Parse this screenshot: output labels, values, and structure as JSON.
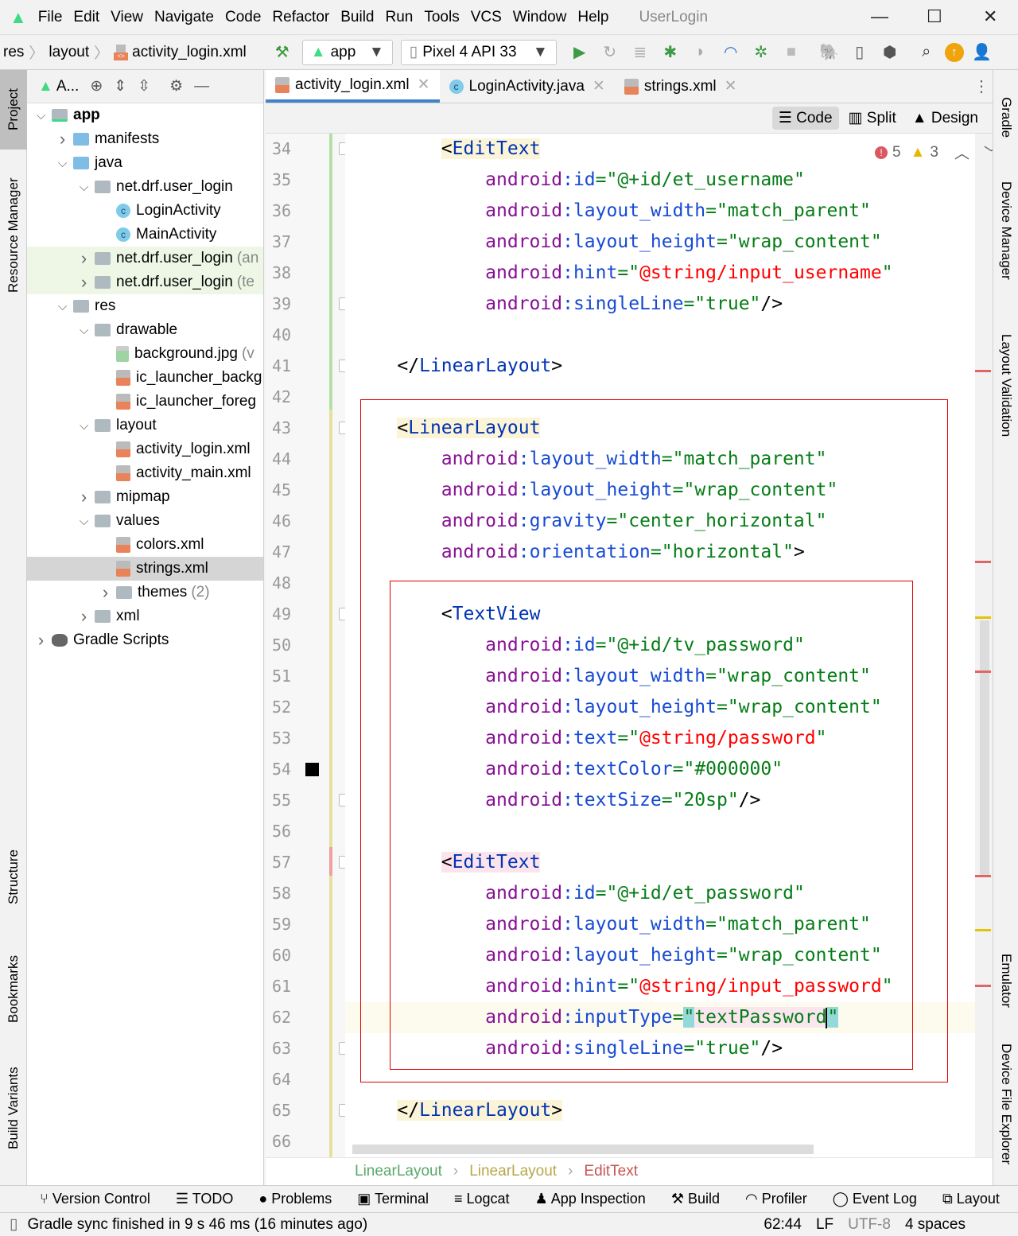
{
  "menu": {
    "items": [
      "File",
      "Edit",
      "View",
      "Navigate",
      "Code",
      "Refactor",
      "Build",
      "Run",
      "Tools",
      "VCS",
      "Window",
      "Help"
    ],
    "title": "UserLogin"
  },
  "nav": {
    "breadcrumb": [
      "res",
      "layout",
      "activity_login.xml"
    ],
    "run_config": "app",
    "device": "Pixel 4 API 33"
  },
  "project_tool": {
    "selector": "A..."
  },
  "left_tabs": [
    "Project",
    "Resource Manager",
    "Structure",
    "Bookmarks",
    "Build Variants"
  ],
  "right_tabs": [
    "Gradle",
    "Device Manager",
    "Layout Validation",
    "Emulator",
    "Device File Explorer"
  ],
  "tree": [
    {
      "label": "app",
      "depth": 0,
      "state": "open",
      "icon": "module",
      "bold": true
    },
    {
      "label": "manifests",
      "depth": 1,
      "state": "closed",
      "icon": "bfolder"
    },
    {
      "label": "java",
      "depth": 1,
      "state": "open",
      "icon": "bfolder"
    },
    {
      "label": "net.drf.user_login",
      "depth": 2,
      "state": "open",
      "icon": "folder"
    },
    {
      "label": "LoginActivity",
      "depth": 3,
      "state": "leaf",
      "icon": "cls"
    },
    {
      "label": "MainActivity",
      "depth": 3,
      "state": "leaf",
      "icon": "cls"
    },
    {
      "label": "net.drf.user_login",
      "suffix": "(an",
      "depth": 2,
      "state": "closed",
      "icon": "folder",
      "green": true
    },
    {
      "label": "net.drf.user_login",
      "suffix": "(te",
      "depth": 2,
      "state": "closed",
      "icon": "folder",
      "green": true
    },
    {
      "label": "res",
      "depth": 1,
      "state": "open",
      "icon": "folder"
    },
    {
      "label": "drawable",
      "depth": 2,
      "state": "open",
      "icon": "folder"
    },
    {
      "label": "background.jpg",
      "suffix": "(v",
      "depth": 3,
      "state": "leaf",
      "icon": "img"
    },
    {
      "label": "ic_launcher_backg",
      "depth": 3,
      "state": "leaf",
      "icon": "xmlf"
    },
    {
      "label": "ic_launcher_foreg",
      "depth": 3,
      "state": "leaf",
      "icon": "xmlf"
    },
    {
      "label": "layout",
      "depth": 2,
      "state": "open",
      "icon": "folder"
    },
    {
      "label": "activity_login.xml",
      "depth": 3,
      "state": "leaf",
      "icon": "xmlf"
    },
    {
      "label": "activity_main.xml",
      "depth": 3,
      "state": "leaf",
      "icon": "xmlf"
    },
    {
      "label": "mipmap",
      "depth": 2,
      "state": "closed",
      "icon": "folder"
    },
    {
      "label": "values",
      "depth": 2,
      "state": "open",
      "icon": "folder"
    },
    {
      "label": "colors.xml",
      "depth": 3,
      "state": "leaf",
      "icon": "xmlf"
    },
    {
      "label": "strings.xml",
      "depth": 3,
      "state": "leaf",
      "icon": "xmlf",
      "selected": true
    },
    {
      "label": "themes",
      "suffix": "(2)",
      "depth": 3,
      "state": "closed",
      "icon": "folder"
    },
    {
      "label": "xml",
      "depth": 2,
      "state": "closed",
      "icon": "folder"
    },
    {
      "label": "Gradle Scripts",
      "depth": 0,
      "state": "closed",
      "icon": "gradle"
    }
  ],
  "tabs": [
    {
      "label": "activity_login.xml",
      "icon": "xml",
      "active": true
    },
    {
      "label": "LoginActivity.java",
      "icon": "class"
    },
    {
      "label": "strings.xml",
      "icon": "xml"
    }
  ],
  "view_modes": [
    {
      "label": "Code",
      "active": true
    },
    {
      "label": "Split"
    },
    {
      "label": "Design"
    }
  ],
  "inspections": {
    "errors": "5",
    "warnings": "3"
  },
  "code": {
    "first_line": 34,
    "current_line": 62,
    "lines": [
      "        <EditText",
      "            android:id=\"@+id/et_username\"",
      "            android:layout_width=\"match_parent\"",
      "            android:layout_height=\"wrap_content\"",
      "            android:hint=\"@string/input_username\"",
      "            android:singleLine=\"true\"/>",
      "",
      "    </LinearLayout>",
      "",
      "    <LinearLayout",
      "        android:layout_width=\"match_parent\"",
      "        android:layout_height=\"wrap_content\"",
      "        android:gravity=\"center_horizontal\"",
      "        android:orientation=\"horizontal\">",
      "",
      "        <TextView",
      "            android:id=\"@+id/tv_password\"",
      "            android:layout_width=\"wrap_content\"",
      "            android:layout_height=\"wrap_content\"",
      "            android:text=\"@string/password\"",
      "            android:textColor=\"#000000\"",
      "            android:textSize=\"20sp\"/>",
      "",
      "        <EditText",
      "            android:id=\"@+id/et_password\"",
      "            android:layout_width=\"match_parent\"",
      "            android:layout_height=\"wrap_content\"",
      "            android:hint=\"@string/input_password\"",
      "            android:inputType=\"textPassword\"",
      "            android:singleLine=\"true\"/>",
      "",
      "    </LinearLayout>",
      ""
    ],
    "color_swatch": "#000000"
  },
  "editor_breadcrumb": [
    "LinearLayout",
    "LinearLayout",
    "EditText"
  ],
  "bottom_tools": [
    "Version Control",
    "TODO",
    "Problems",
    "Terminal",
    "Logcat",
    "App Inspection",
    "Build",
    "Profiler",
    "Event Log",
    "Layout"
  ],
  "status": {
    "message": "Gradle sync finished in 9 s 46 ms (16 minutes ago)",
    "position": "62:44",
    "line_sep": "LF",
    "encoding": "UTF-8",
    "indent": "4 spaces"
  },
  "colors": {
    "accent": "#4083c9",
    "tag": "#0033b3",
    "namespace": "#871094",
    "attribute": "#174ad4",
    "value": "#067d17",
    "resource_ref": "#ff0000",
    "annotation_box": "#e00000"
  }
}
